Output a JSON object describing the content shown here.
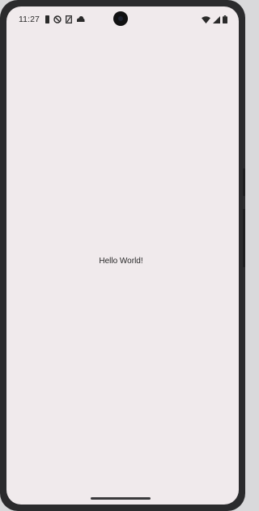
{
  "status_bar": {
    "time": "11:27",
    "notification_icons": [
      "sim-card-icon",
      "vpn-shield-icon",
      "data-saver-icon",
      "cloud-icon"
    ],
    "system_icons": [
      "wifi-icon",
      "cellular-signal-icon",
      "battery-icon"
    ]
  },
  "main": {
    "text": "Hello World!"
  },
  "colors": {
    "screen_background": "#f0eaec",
    "device_frame": "#2b2b2d",
    "text": "#262626"
  }
}
